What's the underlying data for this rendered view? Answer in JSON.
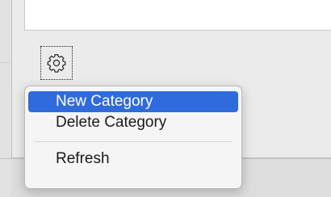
{
  "toolbar": {
    "gear_icon": "gear-icon"
  },
  "context_menu": {
    "items": [
      {
        "label": "New Category",
        "selected": true
      },
      {
        "label": "Delete Category",
        "selected": false
      }
    ],
    "footer_items": [
      {
        "label": "Refresh",
        "selected": false
      }
    ]
  },
  "colors": {
    "selection": "#2f6bdc",
    "menu_background": "#f5f5f5",
    "panel_background": "#ebebeb"
  }
}
